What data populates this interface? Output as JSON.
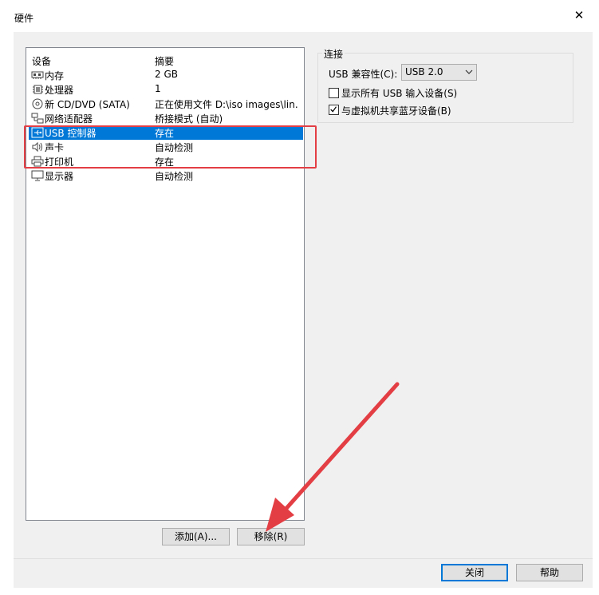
{
  "window": {
    "title": "硬件",
    "close_glyph": "✕"
  },
  "device_list": {
    "header_device": "设备",
    "header_summary": "摘要",
    "items": [
      {
        "name": "内存",
        "summary": "2 GB",
        "icon": "memory-icon"
      },
      {
        "name": "处理器",
        "summary": "1",
        "icon": "cpu-icon"
      },
      {
        "name": "新 CD/DVD (SATA)",
        "summary": "正在使用文件 D:\\iso images\\lin...",
        "icon": "cd-dvd-icon"
      },
      {
        "name": "网络适配器",
        "summary": "桥接模式 (自动)",
        "icon": "network-icon"
      },
      {
        "name": "USB 控制器",
        "summary": "存在",
        "icon": "usb-icon",
        "selected": true
      },
      {
        "name": "声卡",
        "summary": "自动检测",
        "icon": "speaker-icon"
      },
      {
        "name": "打印机",
        "summary": "存在",
        "icon": "printer-icon"
      },
      {
        "name": "显示器",
        "summary": "自动检测",
        "icon": "monitor-icon"
      }
    ]
  },
  "list_buttons": {
    "add": "添加(A)...",
    "remove": "移除(R)"
  },
  "connection": {
    "group_title": "连接",
    "compat_label": "USB 兼容性(C):",
    "compat_value": "USB 2.0",
    "show_all_usb": {
      "label": "显示所有 USB 输入设备(S)",
      "checked": false
    },
    "share_bluetooth": {
      "label": "与虚拟机共享蓝牙设备(B)",
      "checked": true
    }
  },
  "footer_buttons": {
    "close": "关闭",
    "help": "帮助"
  },
  "colors": {
    "selection": "#0078d7",
    "annotation": "#e33e43",
    "dialog_bg": "#f0f0f0"
  }
}
